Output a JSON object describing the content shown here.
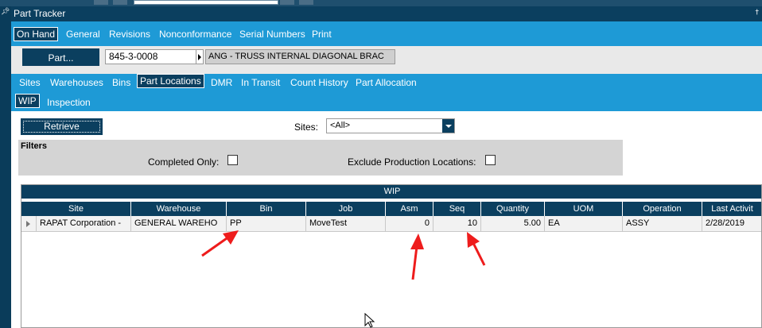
{
  "window": {
    "title": "Part Tracker"
  },
  "main_tabs": [
    {
      "label": "On Hand",
      "active": true
    },
    {
      "label": "General"
    },
    {
      "label": "Revisions"
    },
    {
      "label": "Nonconformance"
    },
    {
      "label": "Serial Numbers"
    },
    {
      "label": "Print"
    }
  ],
  "part": {
    "button_label": "Part...",
    "number": "845-3-0008",
    "description": "ANG - TRUSS INTERNAL DIAGONAL BRAC"
  },
  "sub_tabs": [
    {
      "label": "Sites"
    },
    {
      "label": "Warehouses"
    },
    {
      "label": "Bins"
    },
    {
      "label": "Part Locations",
      "active": true
    },
    {
      "label": "DMR"
    },
    {
      "label": "In Transit"
    },
    {
      "label": "Count History"
    },
    {
      "label": "Part Allocation"
    }
  ],
  "inner_tabs": [
    {
      "label": "WIP",
      "active": true
    },
    {
      "label": "Inspection"
    }
  ],
  "controls": {
    "retrieve_label": "Retrieve",
    "sites_label": "Sites:",
    "sites_value": "<All>"
  },
  "filters": {
    "title": "Filters",
    "completed_only_label": "Completed Only:",
    "completed_only_checked": false,
    "exclude_production_label": "Exclude Production Locations:",
    "exclude_production_checked": false
  },
  "grid": {
    "caption": "WIP",
    "columns": [
      "Site",
      "Warehouse",
      "Bin",
      "Job",
      "Asm",
      "Seq",
      "Quantity",
      "UOM",
      "Operation",
      "Last Activit"
    ],
    "rows": [
      [
        "RAPAT Corporation -",
        "GENERAL WAREHO",
        "PP",
        "MoveTest",
        "0",
        "10",
        "5.00",
        "EA",
        "ASSY",
        "2/28/2019"
      ]
    ]
  },
  "colors": {
    "dark_navy": "#0b3f5f",
    "tab_blue": "#1e9ad6",
    "annotation_red": "#ee1c1c"
  }
}
